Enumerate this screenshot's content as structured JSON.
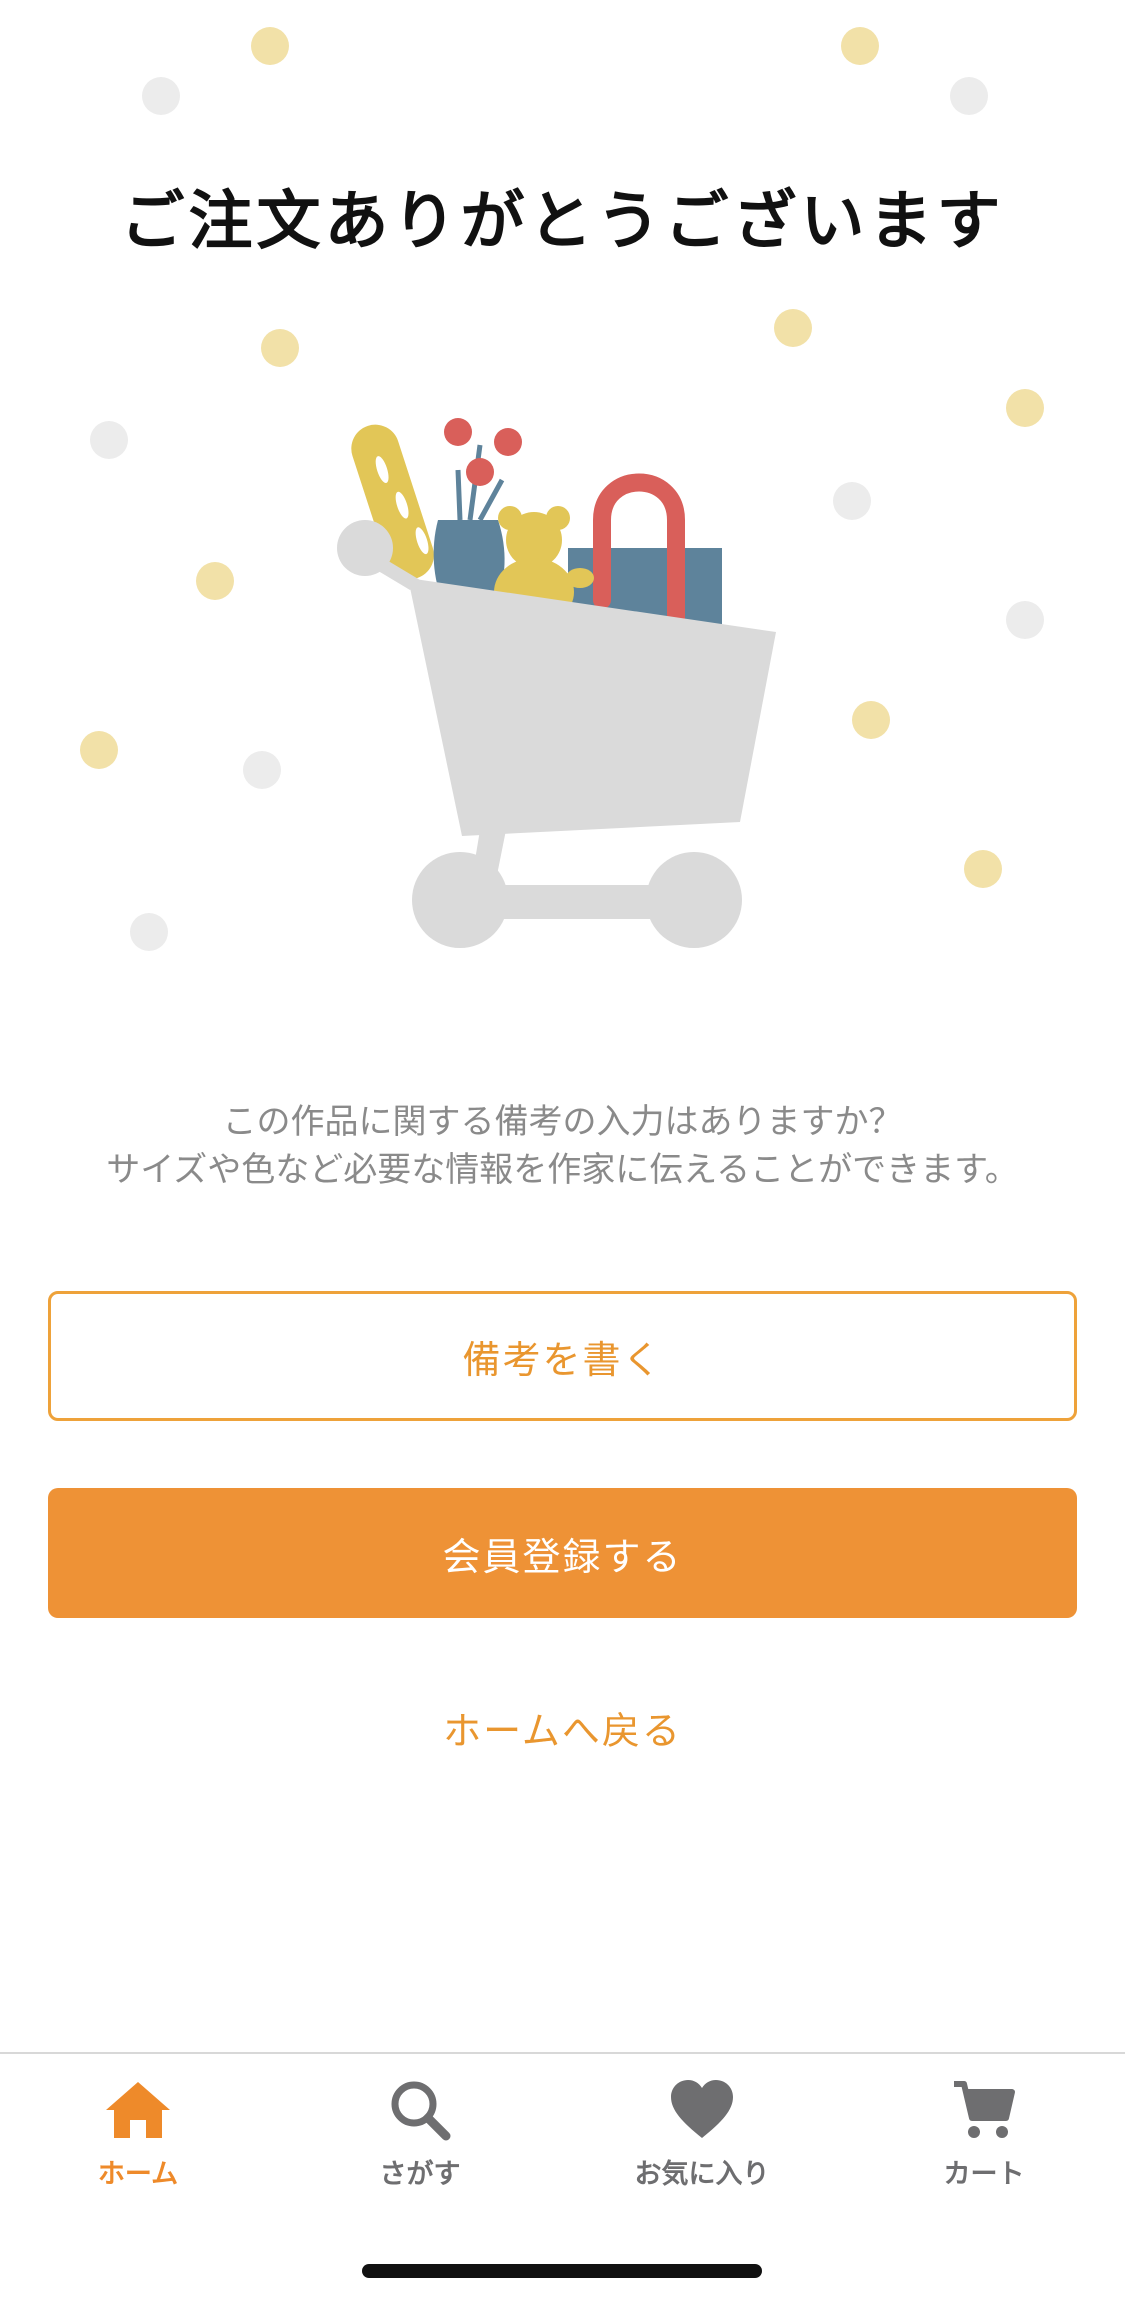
{
  "title": "ご注文ありがとうございます",
  "message": {
    "line1": "この作品に関する備考の入力はありますか？",
    "line2": "サイズや色など必要な情報を作家に伝えることができます。"
  },
  "buttons": {
    "write_note": "備考を書く",
    "register": "会員登録する",
    "back_home": "ホームへ戻る"
  },
  "tabbar": {
    "tabs": [
      {
        "label": "ホーム",
        "icon": "home-icon",
        "active": true
      },
      {
        "label": "さがす",
        "icon": "search-icon",
        "active": false
      },
      {
        "label": "お気に入り",
        "icon": "heart-icon",
        "active": false
      },
      {
        "label": "カート",
        "icon": "cart-icon",
        "active": false
      }
    ]
  },
  "colors": {
    "accent": "#ee9236",
    "accent_text": "#e9962f",
    "inactive_tab": "#6e6e70",
    "message_text": "#8a8a8a",
    "dot_yellow": "#f2e1a8",
    "dot_gray": "#ececec"
  }
}
